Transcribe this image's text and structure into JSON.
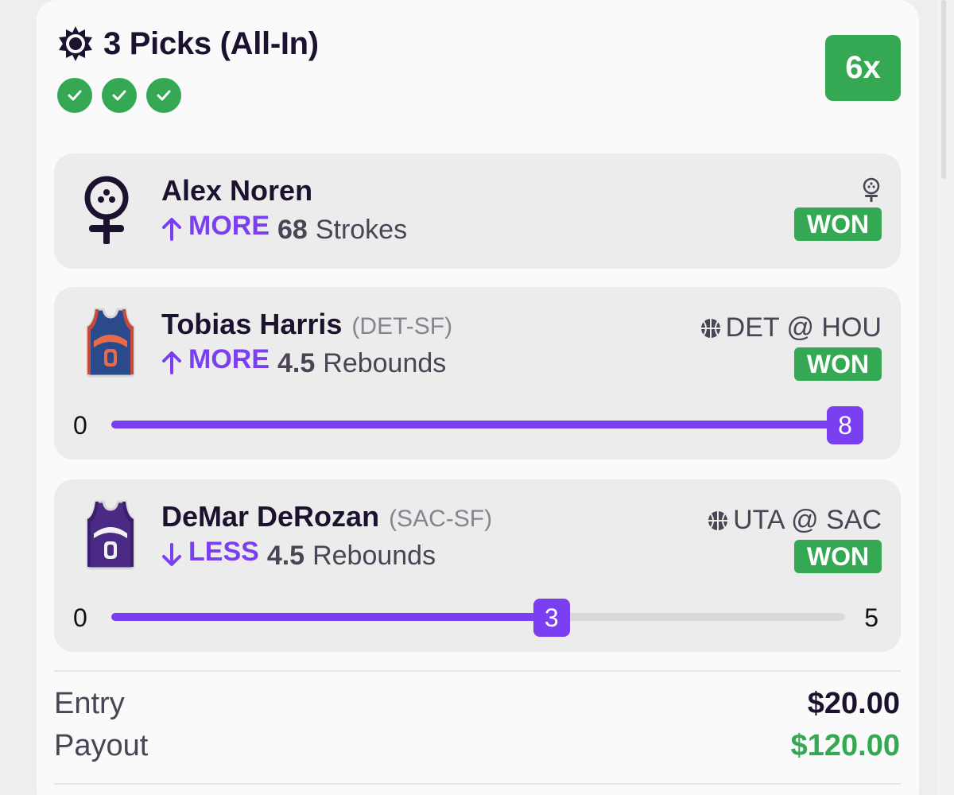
{
  "entry_header": {
    "title": "3 Picks (All-In)",
    "multiplier": "6x",
    "check_count": 3,
    "check_icon": "check-circle-icon"
  },
  "picks": [
    {
      "player": "Alex Noren",
      "team": "",
      "direction": "MORE",
      "direction_icon": "arrow-up-icon",
      "line": "68",
      "stat": "Strokes",
      "matchup": "",
      "sport_icon": "golf-tee-icon",
      "result": "WON"
    },
    {
      "player": "Tobias Harris",
      "team": "(DET-SF)",
      "direction": "MORE",
      "direction_icon": "arrow-up-icon",
      "line": "4.5",
      "stat": "Rebounds",
      "matchup": "DET @ HOU",
      "sport_icon": "basketball-icon",
      "result": "WON",
      "progress": {
        "min": "0",
        "current": "8",
        "max": "",
        "fraction": 1.0
      }
    },
    {
      "player": "DeMar DeRozan",
      "team": "(SAC-SF)",
      "direction": "LESS",
      "direction_icon": "arrow-down-icon",
      "line": "4.5",
      "stat": "Rebounds",
      "matchup": "UTA @ SAC",
      "sport_icon": "basketball-icon",
      "result": "WON",
      "progress": {
        "min": "0",
        "current": "3",
        "max": "5",
        "fraction": 0.6
      }
    }
  ],
  "summary": {
    "entry_label": "Entry",
    "entry_value": "$20.00",
    "payout_label": "Payout",
    "payout_value": "$120.00"
  },
  "colors": {
    "accent_purple": "#7b3ff2",
    "won_green": "#35a853",
    "card_bg": "#fafafa",
    "pick_bg": "#ececec"
  }
}
